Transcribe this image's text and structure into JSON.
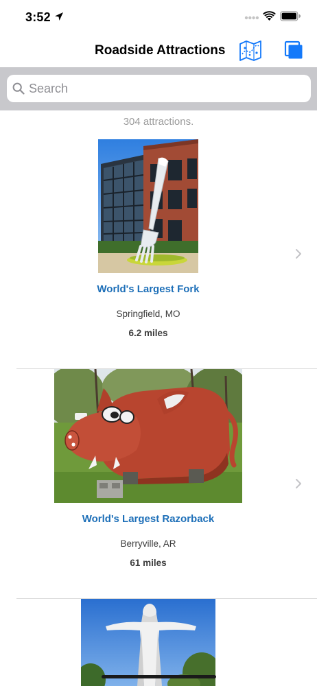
{
  "status_bar": {
    "time": "3:52"
  },
  "nav": {
    "title": "Roadside Attractions",
    "map_icon": "map-icon",
    "copy_icon": "copy-icon"
  },
  "search": {
    "value": "",
    "placeholder": "Search"
  },
  "list": {
    "count_text": "304 attractions.",
    "items": [
      {
        "title": "World's Largest Fork",
        "location": "Springfield, MO",
        "distance": "6.2 miles",
        "image": "giant-fork-photo"
      },
      {
        "title": "World's Largest Razorback",
        "location": "Berryville, AR",
        "distance": "61 miles",
        "image": "razorback-photo"
      },
      {
        "title": "",
        "location": "",
        "distance": "",
        "image": "christ-statue-photo"
      }
    ]
  },
  "colors": {
    "accent": "#1479fa",
    "title_link": "#1d6fb8",
    "search_bar_bg": "#c8c8cc"
  }
}
